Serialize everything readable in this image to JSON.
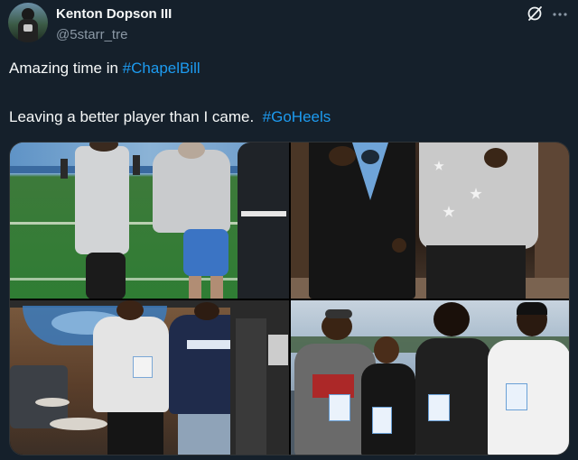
{
  "post": {
    "author_name": "Kenton Dopson III",
    "author_handle": "@5starr_tre",
    "line1_text": "Amazing time in ",
    "line1_tag": "#ChapelBill",
    "line2_text": "Leaving a better player than I came.  ",
    "line2_tag": "#GoHeels"
  },
  "icons": {
    "grok": "grok-icon",
    "more": "more-icon"
  },
  "colors": {
    "background": "#15202b",
    "text": "#f7f9f9",
    "secondary": "#8b98a5",
    "hashtag": "#1d9bf0"
  }
}
